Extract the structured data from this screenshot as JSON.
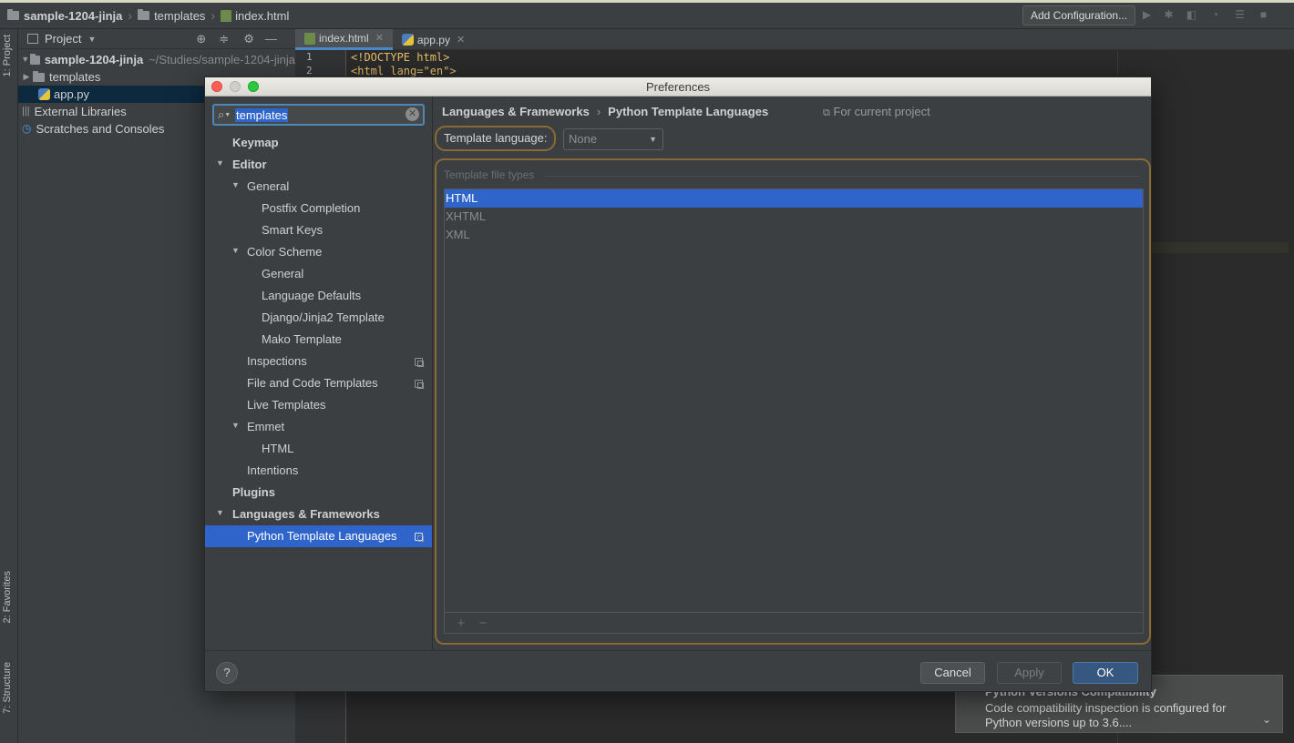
{
  "toolbar": {
    "crumbs": [
      "sample-1204-jinja",
      "templates",
      "index.html"
    ],
    "add_config": "Add Configuration..."
  },
  "left_strip": {
    "project": "1: Project",
    "favorites": "2: Favorites",
    "structure": "7: Structure"
  },
  "project_panel": {
    "header": "Project",
    "root_name": "sample-1204-jinja",
    "root_path": "~/Studies/sample-1204-jinja",
    "items": [
      "templates",
      "app.py",
      "External Libraries",
      "Scratches and Consoles"
    ]
  },
  "editor": {
    "tabs": [
      "index.html",
      "app.py"
    ],
    "lines": [
      "1",
      "2"
    ],
    "code": [
      "<!DOCTYPE html>",
      "<html lang=\"en\">"
    ]
  },
  "dialog": {
    "title": "Preferences",
    "search_value": "templates",
    "sidebar": [
      "Keymap",
      "Editor",
      "General",
      "Postfix Completion",
      "Smart Keys",
      "Color Scheme",
      "General",
      "Language Defaults",
      "Django/Jinja2 Template",
      "Mako Template",
      "Inspections",
      "File and Code Templates",
      "Live Templates",
      "Emmet",
      "HTML",
      "Intentions",
      "Plugins",
      "Languages & Frameworks",
      "Python Template Languages"
    ],
    "breadcrumb": [
      "Languages & Frameworks",
      "Python Template Languages"
    ],
    "for_project": "For current project",
    "template_language_label": "Template language:",
    "template_language_value": "None",
    "types_caption": "Template file types",
    "file_types": [
      "HTML",
      "XHTML",
      "XML"
    ],
    "buttons": {
      "help": "?",
      "cancel": "Cancel",
      "apply": "Apply",
      "ok": "OK"
    }
  },
  "notification": {
    "title": "Python Versions Compatibility",
    "body_line1": "Code compatibility inspection is configured for",
    "body_line2": "Python versions up to 3.6...."
  },
  "colors": {
    "selection": "#2f65ca",
    "focus_outline": "#8a6a34",
    "ok_button": "#365880"
  }
}
